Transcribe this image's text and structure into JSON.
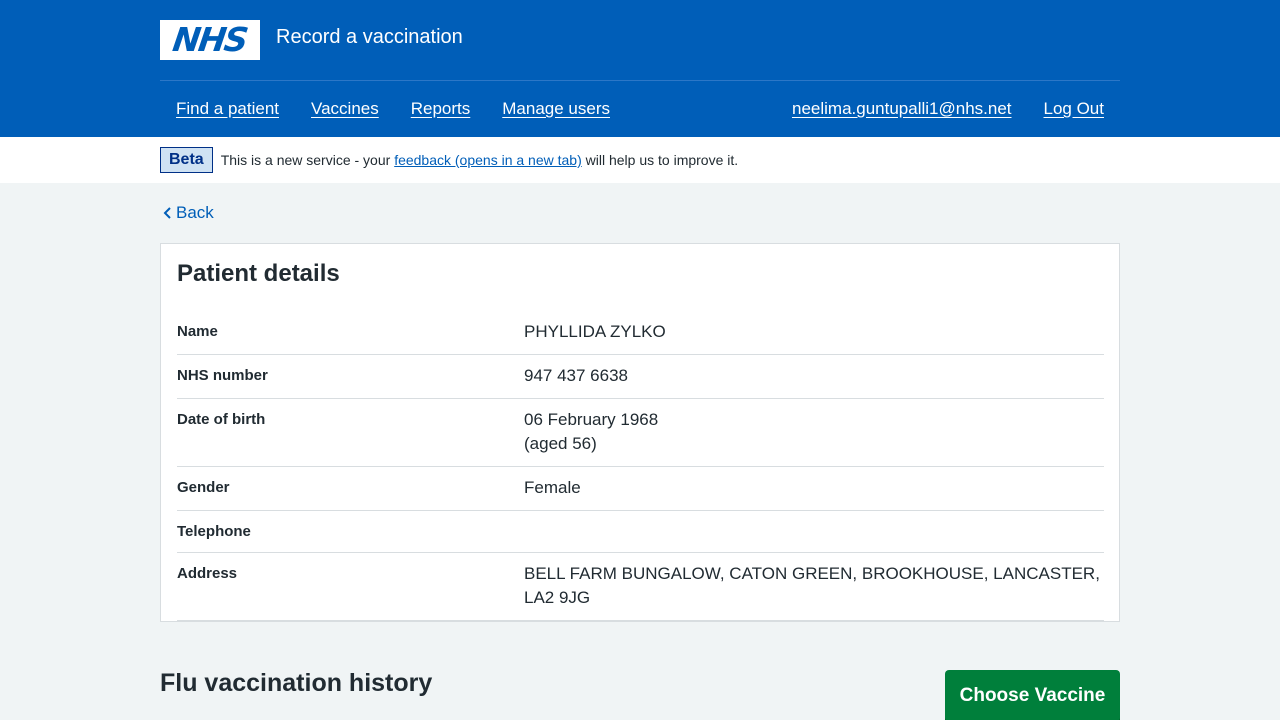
{
  "header": {
    "logo_text": "NHS",
    "service_name": "Record a vaccination",
    "nav_left": [
      "Find a patient",
      "Vaccines",
      "Reports",
      "Manage users"
    ],
    "user_email": "neelima.guntupalli1@nhs.net",
    "logout": "Log Out"
  },
  "beta": {
    "tag": "Beta",
    "text_before": "This is a new service - your ",
    "link": "feedback (opens in a new tab)",
    "text_after": " will help us to improve it."
  },
  "back_label": "Back",
  "patient": {
    "title": "Patient details",
    "rows": [
      {
        "label": "Name",
        "value": "PHYLLIDA ZYLKO"
      },
      {
        "label": "NHS number",
        "value": "947 437 6638"
      },
      {
        "label": "Date of birth",
        "value": "06 February 1968",
        "value2": "(aged 56)"
      },
      {
        "label": "Gender",
        "value": "Female"
      },
      {
        "label": "Telephone",
        "value": ""
      },
      {
        "label": "Address",
        "value": "BELL FARM BUNGALOW, CATON GREEN, BROOKHOUSE, LANCASTER, LA2 9JG"
      }
    ]
  },
  "flu_history_title": "Flu vaccination history",
  "choose_vaccine_label": "Choose Vaccine",
  "colors": {
    "brand_blue": "#005eb8",
    "button_green": "#007f3b",
    "page_bg": "#f0f4f5"
  }
}
